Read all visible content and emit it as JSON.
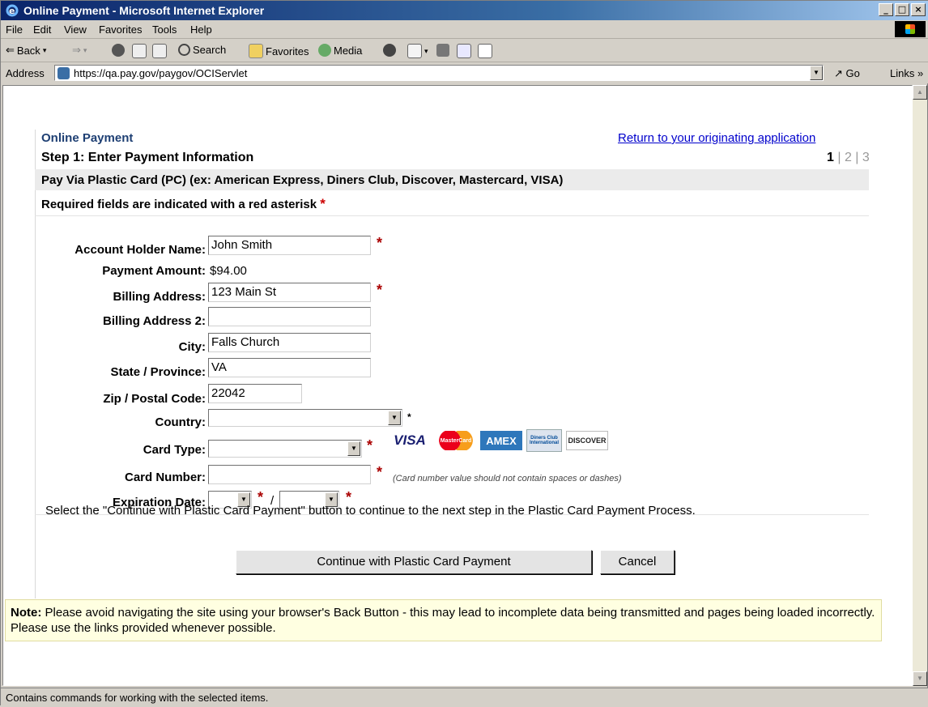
{
  "window": {
    "title": "Online Payment - Microsoft Internet Explorer"
  },
  "menu": [
    "File",
    "Edit",
    "View",
    "Favorites",
    "Tools",
    "Help"
  ],
  "toolbar": {
    "back": "Back",
    "search": "Search",
    "favorites": "Favorites",
    "media": "Media"
  },
  "address": {
    "label": "Address",
    "url": "https://qa.pay.gov/paygov/OCIServlet",
    "go": "Go",
    "links": "Links"
  },
  "page": {
    "title": "Online Payment",
    "return_link": "Return to your originating application",
    "step_heading": "Step 1: Enter Payment Information",
    "steps": [
      "1",
      "2",
      "3"
    ],
    "pay_via": "Pay Via Plastic Card (PC) (ex: American Express, Diners Club, Discover, Mastercard, VISA)",
    "required_note": "Required fields are indicated with a red asterisk",
    "fields": {
      "account_holder": {
        "label": "Account Holder Name:",
        "value": "John Smith"
      },
      "payment_amount": {
        "label": "Payment Amount:",
        "value": "$94.00"
      },
      "billing_address": {
        "label": "Billing Address:",
        "value": "123 Main St"
      },
      "billing_address2": {
        "label": "Billing Address 2:",
        "value": ""
      },
      "city": {
        "label": "City:",
        "value": "Falls Church"
      },
      "state": {
        "label": "State / Province:",
        "value": "VA"
      },
      "zip": {
        "label": "Zip / Postal Code:",
        "value": "22042"
      },
      "country": {
        "label": "Country:",
        "value": ""
      },
      "card_type": {
        "label": "Card Type:",
        "value": ""
      },
      "card_number": {
        "label": "Card Number:",
        "value": "",
        "hint": "(Card number value should not contain spaces or dashes)"
      },
      "expiration": {
        "label": "Expiration Date:",
        "month": "",
        "year": "",
        "separator": "/"
      }
    },
    "card_logos": [
      "VISA",
      "MasterCard",
      "AMEX",
      "Diners Club International",
      "DISCOVER"
    ],
    "instruction": "Select the \"Continue with Plastic Card Payment\" button to continue to the next step in the Plastic Card Payment Process.",
    "continue_button": "Continue with Plastic Card Payment",
    "cancel_button": "Cancel",
    "note_label": "Note:",
    "note_text": " Please avoid navigating the site using your browser's Back Button - this may lead to incomplete data being transmitted and pages being loaded incorrectly. Please use the links provided whenever possible."
  },
  "status": "Contains commands for working with the selected items.",
  "colors": {
    "title_bar": "#0a246a",
    "link": "#0000cc",
    "required": "#cc0000",
    "note_bg": "#ffffe1"
  }
}
